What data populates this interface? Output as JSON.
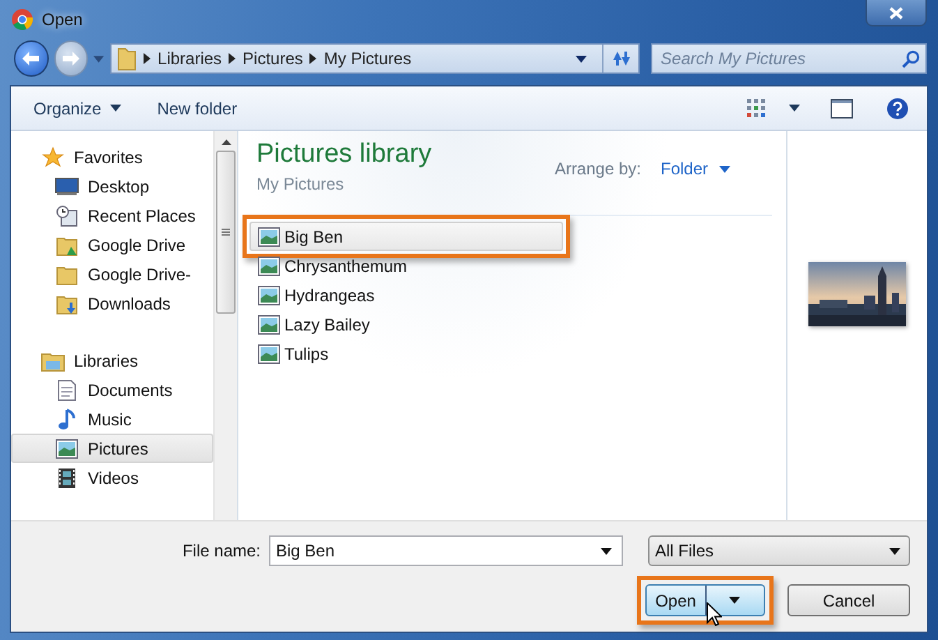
{
  "window": {
    "title": "Open"
  },
  "address": {
    "crumbs": [
      "Libraries",
      "Pictures",
      "My Pictures"
    ]
  },
  "search": {
    "placeholder": "Search My Pictures"
  },
  "toolbar": {
    "organize": "Organize",
    "new_folder": "New folder"
  },
  "nav": [
    {
      "label": "Favorites",
      "children": [
        {
          "label": "Desktop",
          "selected": false
        },
        {
          "label": "Recent Places",
          "selected": false
        },
        {
          "label": "Google Drive",
          "selected": false
        },
        {
          "label": "Google Drive-",
          "selected": false
        },
        {
          "label": "Downloads",
          "selected": false
        }
      ]
    },
    {
      "label": "Libraries",
      "children": [
        {
          "label": "Documents",
          "selected": false
        },
        {
          "label": "Music",
          "selected": false
        },
        {
          "label": "Pictures",
          "selected": true
        },
        {
          "label": "Videos",
          "selected": false
        }
      ]
    }
  ],
  "library": {
    "title": "Pictures library",
    "subtitle": "My Pictures",
    "arrange_label": "Arrange by:",
    "arrange_value": "Folder"
  },
  "files": [
    {
      "name": "Big Ben",
      "selected": true,
      "highlighted": true
    },
    {
      "name": "Chrysanthemum",
      "selected": false,
      "highlighted": false
    },
    {
      "name": "Hydrangeas",
      "selected": false,
      "highlighted": false
    },
    {
      "name": "Lazy Bailey",
      "selected": false,
      "highlighted": false
    },
    {
      "name": "Tulips",
      "selected": false,
      "highlighted": false
    }
  ],
  "bottom": {
    "file_name_label": "File name:",
    "file_name": "Big Ben",
    "file_type": "All Files",
    "open": "Open",
    "open_highlighted": true,
    "cancel": "Cancel"
  }
}
